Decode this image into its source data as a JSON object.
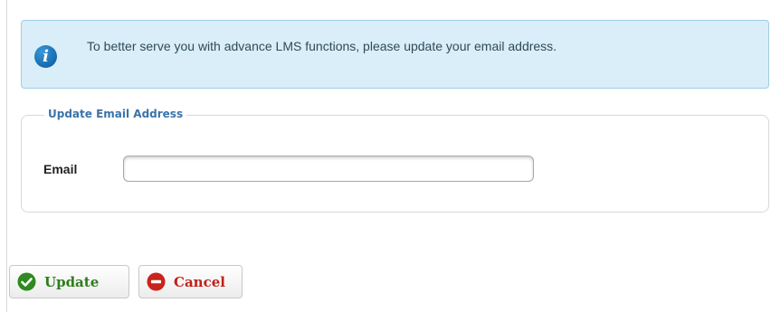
{
  "info": {
    "icon": "info-icon",
    "glyph": "i",
    "message": "To better serve you with advance LMS functions, please update your email address."
  },
  "form": {
    "legend": "Update Email Address",
    "email_label": "Email",
    "email_value": "",
    "email_placeholder": ""
  },
  "actions": {
    "update_label": "Update",
    "cancel_label": "Cancel"
  },
  "colors": {
    "info_bg": "#d9eef8",
    "info_border": "#9fcee4",
    "legend": "#3b73a8",
    "update": "#2e7d1a",
    "cancel": "#c0201a"
  }
}
